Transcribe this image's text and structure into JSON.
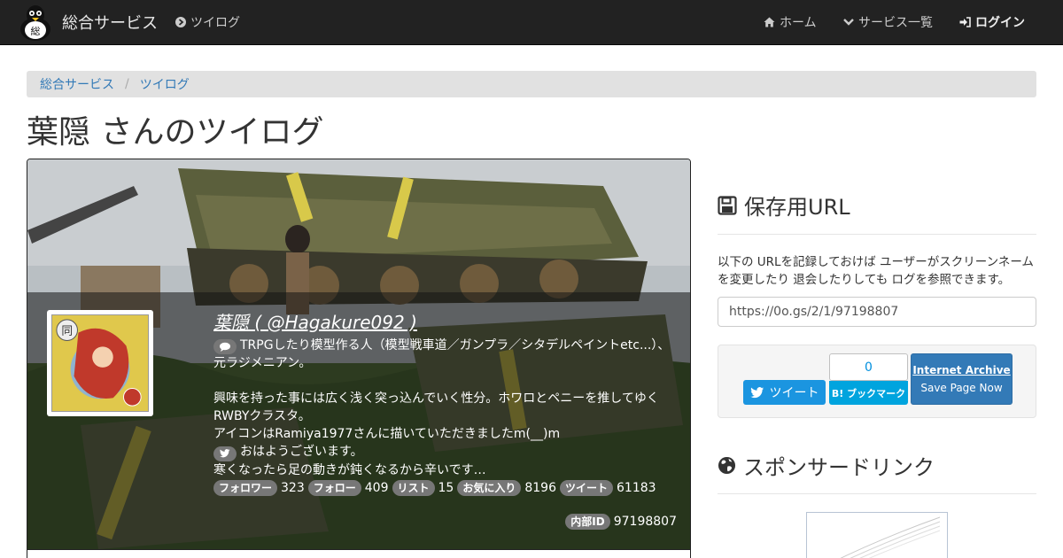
{
  "nav": {
    "brand": "総合サービス",
    "brand_logo_char": "総",
    "sub": "ツイログ",
    "home": "ホーム",
    "services": "サービス一覧",
    "login": "ログイン"
  },
  "breadcrumb": [
    "総合サービス",
    "ツイログ"
  ],
  "page_title": "葉隠 さんのツイログ",
  "profile": {
    "name": "葉隠 ( @Hagakure092 )",
    "bio_lines": [
      "TRPGしたり模型作る人（模型戦車道／ガンプラ／シタデルペイントetc...）、",
      "元ラジメニアン。",
      "",
      "興味を持った事には広く浅く突っ込んでいく性分。ホワロとペニーを推してゆく",
      "RWBYクラスタ。",
      "アイコンはRamiya1977さんに描いていただきましたm(__)m"
    ],
    "tweet_lines": [
      "おはようございます。",
      "寒くなったら足の動きが鈍くなるから辛いです…"
    ],
    "stats": [
      {
        "label": "フォロワー",
        "value": "323"
      },
      {
        "label": "フォロー",
        "value": "409"
      },
      {
        "label": "リスト",
        "value": "15"
      },
      {
        "label": "お気に入り",
        "value": "8196"
      },
      {
        "label": "ツイート",
        "value": "61183"
      }
    ],
    "internal_label": "内部ID",
    "internal_id": "97198807",
    "avatar_char": "同"
  },
  "save": {
    "heading": "保存用URL",
    "description": "以下の URLを記録しておけば ユーザーがスクリーンネームを変更したり 退会したりしても ログを参照できます。",
    "url": "https://0o.gs/2/1/97198807"
  },
  "share": {
    "tweet": "ツイート",
    "hatena_count": "0",
    "hatena": "B! ブックマーク",
    "ia_title": "Internet Archive",
    "ia_sub": "Save Page Now"
  },
  "sponsor": {
    "heading": "スポンサードリンク"
  },
  "colors": {
    "navbar": "#222222",
    "link": "#337ab7",
    "twitter": "#1b95e0",
    "hatena": "#00a4de"
  }
}
